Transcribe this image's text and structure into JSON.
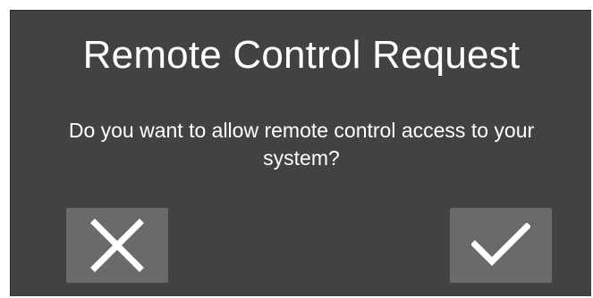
{
  "dialog": {
    "title": "Remote Control Request",
    "message": "Do you want to allow remote control access to your system?",
    "buttons": {
      "deny": {
        "icon": "close-icon"
      },
      "allow": {
        "icon": "checkmark-icon"
      }
    }
  },
  "colors": {
    "dialog_background": "#424242",
    "button_background": "#6a6a6a",
    "text": "#ffffff"
  }
}
